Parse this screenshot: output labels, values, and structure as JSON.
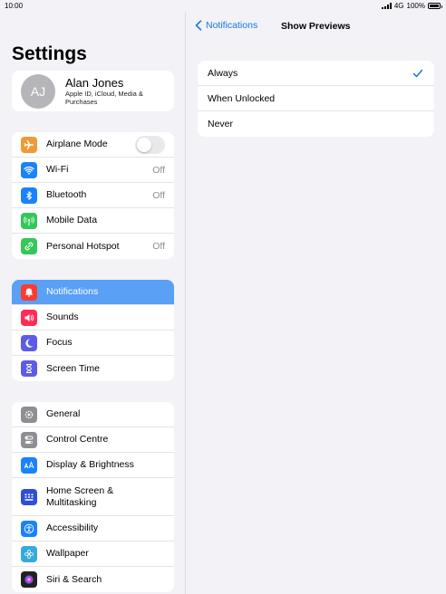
{
  "status": {
    "time": "10:00",
    "network": "4G",
    "battery": "100%"
  },
  "sidebar": {
    "title": "Settings",
    "profile": {
      "initials": "AJ",
      "name": "Alan Jones",
      "subtitle": "Apple ID, iCloud, Media & Purchases"
    },
    "groups": [
      [
        {
          "label": "Airplane Mode",
          "icon": "airplane-icon",
          "color": "#f09a37",
          "toggle": false
        },
        {
          "label": "Wi-Fi",
          "icon": "wifi-icon",
          "color": "#1a82fb",
          "value": "Off"
        },
        {
          "label": "Bluetooth",
          "icon": "bluetooth-icon",
          "color": "#1a82fb",
          "value": "Off"
        },
        {
          "label": "Mobile Data",
          "icon": "antenna-icon",
          "color": "#34c759"
        },
        {
          "label": "Personal Hotspot",
          "icon": "hotspot-icon",
          "color": "#34c759",
          "value": "Off"
        }
      ],
      [
        {
          "label": "Notifications",
          "icon": "bell-icon",
          "color": "#ff3b30",
          "selected": true
        },
        {
          "label": "Sounds",
          "icon": "speaker-icon",
          "color": "#ff2d55"
        },
        {
          "label": "Focus",
          "icon": "moon-icon",
          "color": "#5e5ce6"
        },
        {
          "label": "Screen Time",
          "icon": "hourglass-icon",
          "color": "#5e5ce6"
        }
      ],
      [
        {
          "label": "General",
          "icon": "gear-icon",
          "color": "#8e8e93"
        },
        {
          "label": "Control Centre",
          "icon": "switches-icon",
          "color": "#8e8e93"
        },
        {
          "label": "Display & Brightness",
          "icon": "text-size-icon",
          "color": "#1a82fb"
        },
        {
          "label": "Home Screen & Multitasking",
          "icon": "home-grid-icon",
          "color": "#2f4fd8",
          "tall": true
        },
        {
          "label": "Accessibility",
          "icon": "accessibility-icon",
          "color": "#1a82fb"
        },
        {
          "label": "Wallpaper",
          "icon": "flower-icon",
          "color": "#36aadc"
        },
        {
          "label": "Siri & Search",
          "icon": "siri-icon",
          "color": "#222222"
        }
      ]
    ]
  },
  "detail": {
    "back_label": "Notifications",
    "title": "Show Previews",
    "options": [
      {
        "label": "Always",
        "checked": true
      },
      {
        "label": "When Unlocked",
        "checked": false
      },
      {
        "label": "Never",
        "checked": false
      }
    ],
    "accent": "#1677e6"
  }
}
